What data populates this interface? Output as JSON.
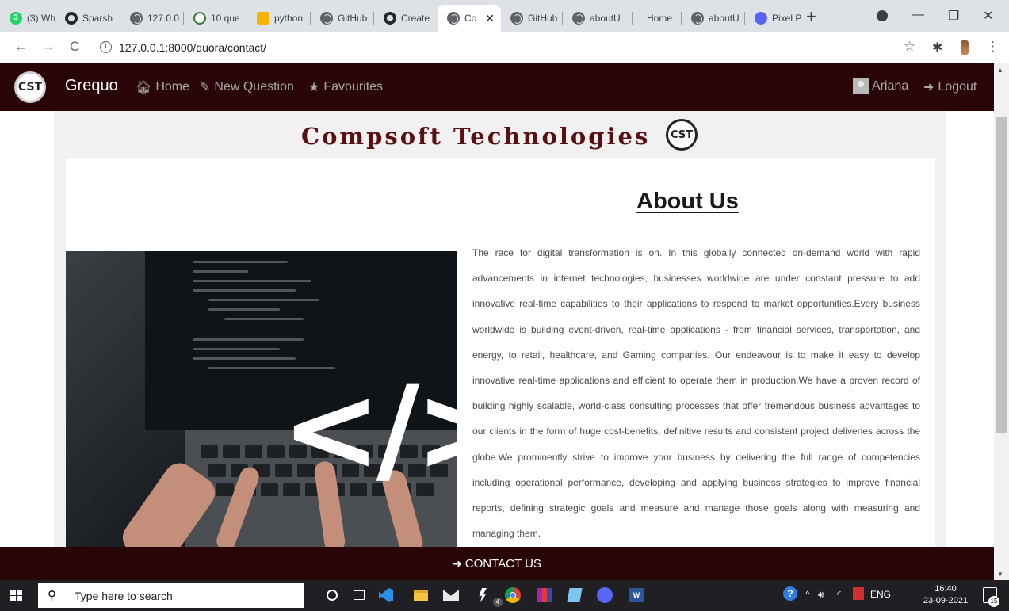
{
  "browser": {
    "tabs": [
      {
        "label": "(3) Wh",
        "icon": "whatsapp-icon",
        "active": false
      },
      {
        "label": "Sparsh",
        "icon": "github-icon",
        "active": false
      },
      {
        "label": "127.0.0",
        "icon": "globe-icon",
        "active": false
      },
      {
        "label": "10 que",
        "icon": "quiz-icon",
        "active": false
      },
      {
        "label": "python",
        "icon": "python-icon",
        "active": false
      },
      {
        "label": "GitHub",
        "icon": "globe-icon",
        "active": false
      },
      {
        "label": "Create",
        "icon": "github-icon",
        "active": false
      },
      {
        "label": "Co",
        "icon": "globe-icon",
        "active": true
      },
      {
        "label": "GitHub",
        "icon": "globe-icon",
        "active": false
      },
      {
        "label": "aboutU",
        "icon": "globe-icon",
        "active": false
      },
      {
        "label": "Home",
        "icon": "none",
        "active": false
      },
      {
        "label": "aboutU",
        "icon": "globe-icon",
        "active": false
      },
      {
        "label": "Pixel P",
        "icon": "discord-icon",
        "active": false
      }
    ],
    "new_tab_glyph": "+",
    "close_tab_glyph": "✕",
    "window_controls": {
      "minimize": "—",
      "restore": "❐",
      "close": "✕"
    },
    "nav": {
      "back": "←",
      "forward": "→",
      "reload": "C",
      "info": "i"
    },
    "url": "127.0.0.1:8000/quora/contact/",
    "toolbar": {
      "bookmark": "☆",
      "extensions": "✱",
      "menu": "⋮"
    }
  },
  "site": {
    "logo_text": "CST",
    "brand": "Grequo",
    "nav_links": [
      {
        "label": "Home",
        "icon": "home-icon",
        "glyph": "🏠︎"
      },
      {
        "label": "New Question",
        "icon": "edit-icon",
        "glyph": "✎"
      },
      {
        "label": "Favourites",
        "icon": "star-icon",
        "glyph": "★"
      }
    ],
    "user_name": "Ariana",
    "logout": {
      "label": "Logout",
      "icon": "logout-icon",
      "glyph": "➜"
    }
  },
  "header": {
    "company_name": "Compsoft Technologies",
    "company_logo_text": "CST"
  },
  "about": {
    "title": "About Us",
    "image_overlay": "</>",
    "paragraph": "The race for digital transformation is on. In this globally connected on-demand world with rapid advancements in internet technologies, businesses worldwide are under constant pressure to add innovative real-time capabilities to their applications to respond to market opportunities.Every business worldwide is building event-driven, real-time applications - from financial services, transportation, and energy, to retail, healthcare, and Gaming companies. Our endeavour is to make it easy to develop innovative real-time applications and efficient to operate them in production.We have a proven record of building highly scalable, world-class consulting processes that offer tremendous business advantages to our clients in the form of huge cost-benefits, definitive results and consistent project deliveries across the globe.We prominently strive to improve your business by delivering the full range of competencies including operational performance, developing and applying business strategies to improve financial reports, defining strategic goals and measure and manage those goals along with measuring and managing them."
  },
  "footer": {
    "contact_label": "CONTACT US",
    "contact_icon": "sign-in-icon",
    "contact_glyph": "➜"
  },
  "taskbar": {
    "search_placeholder": "Type here to search",
    "search_glyph": "⚲",
    "mail_badge": "4",
    "tray": {
      "help": "?",
      "chevron": "^",
      "volume": "🔊︎",
      "wifi": "◜",
      "language": "ENG"
    },
    "time": "16:40",
    "date": "23-09-2021",
    "notifications": "15"
  },
  "colors": {
    "navbar": "#2a0508",
    "company_title": "#5a0f12",
    "tab_bar": "#dee1e6",
    "taskbar": "#1f1f24"
  }
}
